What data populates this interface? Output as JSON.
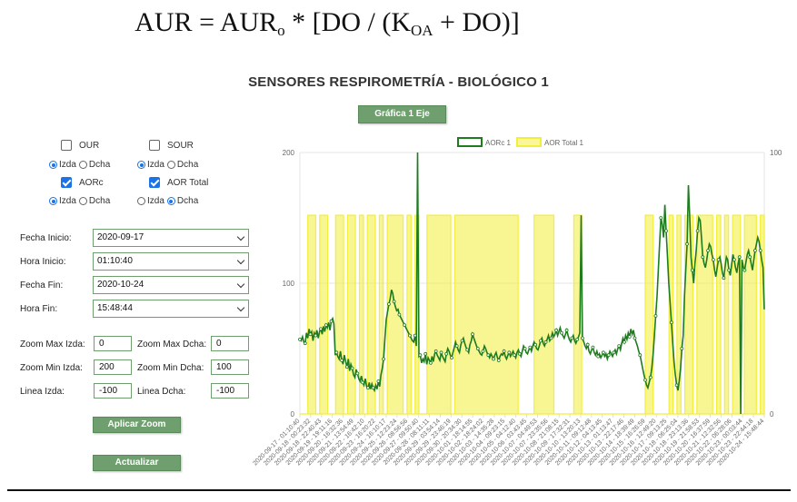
{
  "formula": {
    "lhs": "AUR",
    "eq": " = ",
    "aur0_base": "AUR",
    "aur0_sub": "o",
    "middle": " * [DO / (K",
    "koa_sub": "OA",
    "tail": " + DO)]"
  },
  "page_title": "SENSORES RESPIROMETRÍA - BIOLÓGICO 1",
  "chart_mode_button": "Gráfica 1 Eje",
  "sensors": [
    {
      "label": "OUR",
      "checked": false,
      "axis": "Izda"
    },
    {
      "label": "SOUR",
      "checked": false,
      "axis": "Izda"
    },
    {
      "label": "AORc",
      "checked": true,
      "axis": "Izda"
    },
    {
      "label": "AOR Total",
      "checked": true,
      "axis": "Dcha"
    }
  ],
  "axis_labels": {
    "left": "Izda",
    "right": "Dcha"
  },
  "form": {
    "fecha_inicio": {
      "label": "Fecha Inicio:",
      "value": "2020-09-17"
    },
    "hora_inicio": {
      "label": "Hora Inicio:",
      "value": "01:10:40"
    },
    "fecha_fin": {
      "label": "Fecha Fin:",
      "value": "2020-10-24"
    },
    "hora_fin": {
      "label": "Hora Fin:",
      "value": "15:48:44"
    }
  },
  "zoom": {
    "max_izda": {
      "label": "Zoom Max Izda:",
      "value": "0"
    },
    "max_dcha": {
      "label": "Zoom Max Dcha:",
      "value": "0"
    },
    "min_izda": {
      "label": "Zoom Min Izda:",
      "value": "200"
    },
    "min_dcha": {
      "label": "Zoom Min Dcha:",
      "value": "100"
    },
    "linea_izda": {
      "label": "Linea Izda:",
      "value": "-100"
    },
    "linea_dcha": {
      "label": "Linea Dcha:",
      "value": "-100"
    }
  },
  "apply_zoom_button": "Aplicar Zoom",
  "refresh_button": "Actualizar",
  "chart_data": {
    "type": "line",
    "title": "",
    "legend": [
      "AORc 1",
      "AOR Total 1"
    ],
    "legend_position": "top",
    "colors": {
      "aorc": "#1e7b1e",
      "aortotal": "#f3ee3a"
    },
    "y_left": {
      "ticks": [
        "200",
        "100",
        "0"
      ],
      "range": [
        0,
        200
      ]
    },
    "y_right": {
      "ticks": [
        "100",
        "0"
      ],
      "range": [
        0,
        100
      ]
    },
    "x_tick_labels": [
      "2020-09-17 - 01:10:40",
      "2020-09-18 - 00:23:32",
      "2020-09-18 - 22:40:43",
      "2020-09-19 - 19:11:16",
      "2020-09-20 - 16:32:36",
      "2020-09-21 - 13:54:49",
      "2020-09-22 - 16:42:10",
      "2020-09-23 - 16:20:22",
      "2020-09-24 - 16:10:17",
      "2020-09-25 - 12:23:24",
      "2020-09-26 - 08:56:56",
      "2020-09-27 - 09:50:40",
      "2020-09-28 - 08:11:11",
      "2020-09-29 - 03:54:14",
      "2020-09-29 - 23:46:19",
      "2020-09-30 - 20:34:30",
      "2020-10-01 - 18:14:55",
      "2020-10-02 - 18:24:02",
      "2020-10-03 - 14:35:28",
      "2020-10-04 - 09:23:15",
      "2020-10-05 - 04:12:40",
      "2020-10-06 - 03:43:45",
      "2020-10-07 - 04:49:53",
      "2020-10-07 - 23:35:56",
      "2020-10-08 - 21:08:15",
      "2020-10-09 - 17:32:31",
      "2020-10-10 - 13:20:13",
      "2020-10-11 - 09:12:48",
      "2020-10-12 - 04:13:45",
      "2020-10-13 - 01:13:47",
      "2020-10-13 - 22:17:46",
      "2020-10-14 - 18:39:49",
      "2020-10-15 - 16:26:59",
      "2020-10-16 - 12:49:20",
      "2020-10-17 - 09:13:25",
      "2020-10-18 - 06:25:04",
      "2020-10-18 - 23:13:36",
      "2020-10-19 - 21:58:53",
      "2020-10-20 - 16:37:59",
      "2020-10-21 - 12:32:56",
      "2020-10-22 - 06:28:06",
      "2020-10-23 - 00:03:44",
      "2020-10-23 - 22:44:18",
      "2020-10-24 - 15:48:44"
    ],
    "series": [
      {
        "name": "AORc 1",
        "axis": "left",
        "values": [
          57,
          56,
          59,
          55,
          54,
          62,
          58,
          65,
          61,
          63,
          56,
          62,
          60,
          64,
          58,
          63,
          65,
          61,
          67,
          63,
          68,
          66,
          70,
          64,
          71,
          73,
          69,
          45,
          47,
          44,
          42,
          48,
          41,
          38,
          45,
          40,
          36,
          42,
          33,
          38,
          35,
          30,
          28,
          34,
          31,
          27,
          25,
          29,
          24,
          22,
          27,
          21,
          20,
          24,
          19,
          23,
          20,
          18,
          22,
          19,
          25,
          21,
          30,
          35,
          42,
          58,
          72,
          78,
          84,
          88,
          95,
          92,
          86,
          82,
          79,
          80,
          76,
          74,
          72,
          70,
          68,
          66,
          64,
          62,
          60,
          58,
          56,
          55,
          60,
          52,
          200,
          44,
          45,
          39,
          42,
          40,
          46,
          38,
          43,
          41,
          39,
          44,
          40,
          46,
          48,
          45,
          43,
          41,
          47,
          44,
          42,
          40,
          46,
          50,
          48,
          45,
          43,
          47,
          51,
          55,
          52,
          49,
          47,
          53,
          56,
          58,
          54,
          51,
          49,
          47,
          53,
          56,
          61,
          58,
          55,
          52,
          50,
          48,
          46,
          45,
          48,
          52,
          50,
          47,
          45,
          43,
          46,
          44,
          42,
          45,
          47,
          43,
          41,
          44,
          46,
          45,
          48,
          44,
          42,
          45,
          47,
          44,
          46,
          48,
          45,
          43,
          47,
          49,
          46,
          44,
          48,
          52,
          50,
          47,
          46,
          49,
          51,
          48,
          52,
          55,
          53,
          50,
          49,
          52,
          56,
          58,
          54,
          52,
          55,
          57,
          60,
          56,
          58,
          62,
          59,
          61,
          64,
          60,
          63,
          66,
          62,
          60,
          58,
          61,
          64,
          60,
          57,
          55,
          58,
          60,
          56,
          54,
          57,
          59,
          62,
          152,
          58,
          55,
          52,
          50,
          53,
          48,
          46,
          49,
          51,
          47,
          45,
          48,
          44,
          46,
          43,
          45,
          47,
          44,
          46,
          42,
          45,
          48,
          46,
          44,
          47,
          49,
          46,
          50,
          52,
          49,
          54,
          58,
          55,
          60,
          57,
          62,
          59,
          65,
          61,
          64,
          58,
          55,
          52,
          48,
          45,
          40,
          35,
          30,
          26,
          22,
          20,
          24,
          28,
          35,
          45,
          60,
          75,
          90,
          110,
          130,
          150,
          145,
          135,
          160,
          140,
          120,
          100,
          85,
          70,
          55,
          40,
          30,
          22,
          18,
          25,
          35,
          50,
          60,
          90,
          110,
          130,
          175,
          150,
          120,
          110,
          100,
          115,
          125,
          140,
          150,
          148,
          135,
          120,
          115,
          112,
          118,
          125,
          130,
          128,
          122,
          118,
          110,
          105,
          112,
          118,
          120,
          115,
          108,
          104,
          112,
          120,
          118,
          110,
          106,
          114,
          122,
          118,
          112,
          108,
          115,
          120,
          0,
          118,
          112,
          110,
          116,
          122,
          125,
          120,
          115,
          110,
          118,
          125,
          130,
          135,
          132,
          125,
          118,
          112,
          80
        ]
      },
      {
        "name": "AOR Total 1",
        "axis": "right",
        "fill": true,
        "values": [
          0,
          0,
          76,
          76,
          0,
          76,
          76,
          0,
          0,
          76,
          76,
          0,
          76,
          76,
          0,
          76,
          0,
          76,
          76,
          0,
          76,
          0,
          76,
          76,
          76,
          76,
          0,
          76,
          0,
          76,
          0,
          0,
          76,
          76,
          76,
          76,
          76,
          76,
          0,
          76,
          76,
          76,
          76,
          76,
          76,
          76,
          76,
          76,
          76,
          76,
          76,
          76,
          76,
          76,
          76,
          0,
          0,
          0,
          0,
          76,
          76,
          76,
          76,
          76,
          0,
          0,
          0,
          0,
          0,
          76,
          76,
          0,
          0,
          0,
          0,
          0,
          0,
          0,
          0,
          0,
          0,
          0,
          0,
          0,
          0,
          0,
          0,
          76,
          76,
          0,
          0,
          0,
          0,
          76,
          0,
          76,
          0,
          76,
          76,
          0,
          76,
          76,
          76,
          76,
          0,
          76,
          0,
          76,
          0,
          76,
          76,
          0,
          76,
          76,
          76,
          0,
          76
        ]
      }
    ]
  }
}
